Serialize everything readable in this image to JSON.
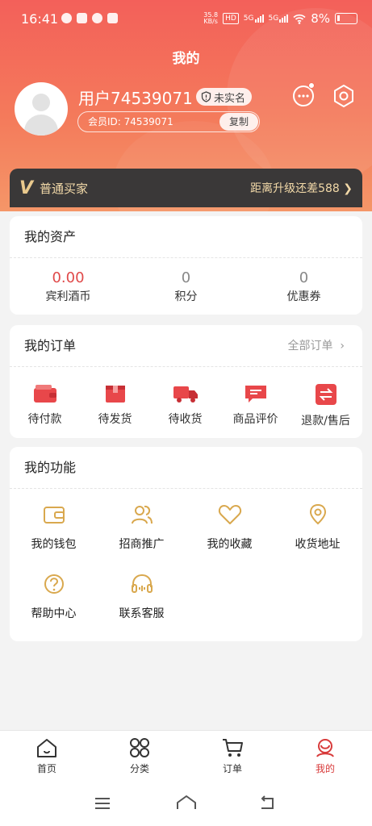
{
  "status_bar": {
    "time": "16:41",
    "net_speed": "35.8",
    "net_unit": "KB/s",
    "hd": "HD",
    "net_type_1": "5G",
    "net_type_2": "5G",
    "battery": "8%"
  },
  "header": {
    "title": "我的",
    "username": "用户74539071",
    "verify_badge": "未实名",
    "member_id": "会员ID: 74539071",
    "copy_label": "复制"
  },
  "vip": {
    "logo": "V",
    "level": "普通买家",
    "upgrade": "距离升级还差588"
  },
  "assets": {
    "title": "我的资产",
    "items": [
      {
        "value": "0.00",
        "label": "宾利酒币"
      },
      {
        "value": "0",
        "label": "积分"
      },
      {
        "value": "0",
        "label": "优惠券"
      }
    ]
  },
  "orders": {
    "title": "我的订单",
    "all_label": "全部订单",
    "items": [
      {
        "label": "待付款",
        "icon": "wallet-icon"
      },
      {
        "label": "待发货",
        "icon": "box-icon"
      },
      {
        "label": "待收货",
        "icon": "truck-icon"
      },
      {
        "label": "商品评价",
        "icon": "comment-icon"
      },
      {
        "label": "退款/售后",
        "icon": "refund-icon"
      }
    ]
  },
  "functions": {
    "title": "我的功能",
    "items": [
      {
        "label": "我的钱包",
        "icon": "wallet-icon"
      },
      {
        "label": "招商推广",
        "icon": "users-icon"
      },
      {
        "label": "我的收藏",
        "icon": "heart-icon"
      },
      {
        "label": "收货地址",
        "icon": "location-icon"
      },
      {
        "label": "帮助中心",
        "icon": "help-icon"
      },
      {
        "label": "联系客服",
        "icon": "headset-icon"
      }
    ]
  },
  "tabbar": {
    "items": [
      {
        "label": "首页",
        "icon": "home-icon"
      },
      {
        "label": "分类",
        "icon": "grid-icon"
      },
      {
        "label": "订单",
        "icon": "cart-icon"
      },
      {
        "label": "我的",
        "icon": "user-icon",
        "active": true
      }
    ]
  },
  "colors": {
    "header_gradient_start": "#f3605a",
    "header_gradient_end": "#f59668",
    "accent_red": "#e04a4a",
    "gold": "#d9a84e",
    "vip_bar": "#3a3838"
  }
}
